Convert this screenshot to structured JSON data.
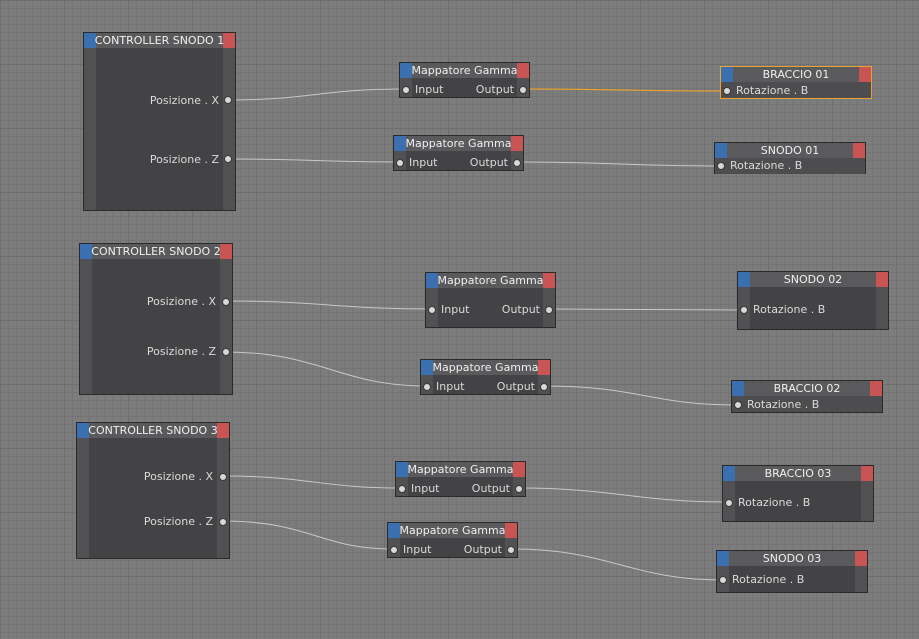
{
  "controllers": [
    {
      "title": "CONTROLLER SNODO 1",
      "port_x": "Posizione . X",
      "port_z": "Posizione . Z"
    },
    {
      "title": "CONTROLLER SNODO 2",
      "port_x": "Posizione . X",
      "port_z": "Posizione . Z"
    },
    {
      "title": "CONTROLLER SNODO 3",
      "port_x": "Posizione . X",
      "port_z": "Posizione . Z"
    }
  ],
  "mappers": [
    {
      "title": "Mappatore Gamma",
      "input": "Input",
      "output": "Output"
    },
    {
      "title": "Mappatore Gamma",
      "input": "Input",
      "output": "Output"
    },
    {
      "title": "Mappatore Gamma",
      "input": "Input",
      "output": "Output"
    },
    {
      "title": "Mappatore Gamma",
      "input": "Input",
      "output": "Output"
    },
    {
      "title": "Mappatore Gamma",
      "input": "Input",
      "output": "Output"
    },
    {
      "title": "Mappatore Gamma",
      "input": "Input",
      "output": "Output"
    }
  ],
  "targets": [
    {
      "title": "BRACCIO 01",
      "port": "Rotazione . B"
    },
    {
      "title": "SNODO 01",
      "port": "Rotazione . B"
    },
    {
      "title": "SNODO 02",
      "port": "Rotazione . B"
    },
    {
      "title": "BRACCIO 02",
      "port": "Rotazione . B"
    },
    {
      "title": "BRACCIO 03",
      "port": "Rotazione . B"
    },
    {
      "title": "SNODO 03",
      "port": "Rotazione . B"
    }
  ],
  "colors": {
    "header_blue": "#3a6fb0",
    "header_red": "#c95454",
    "wire": "#c8c8c8",
    "wire_selected": "#e8a232"
  }
}
